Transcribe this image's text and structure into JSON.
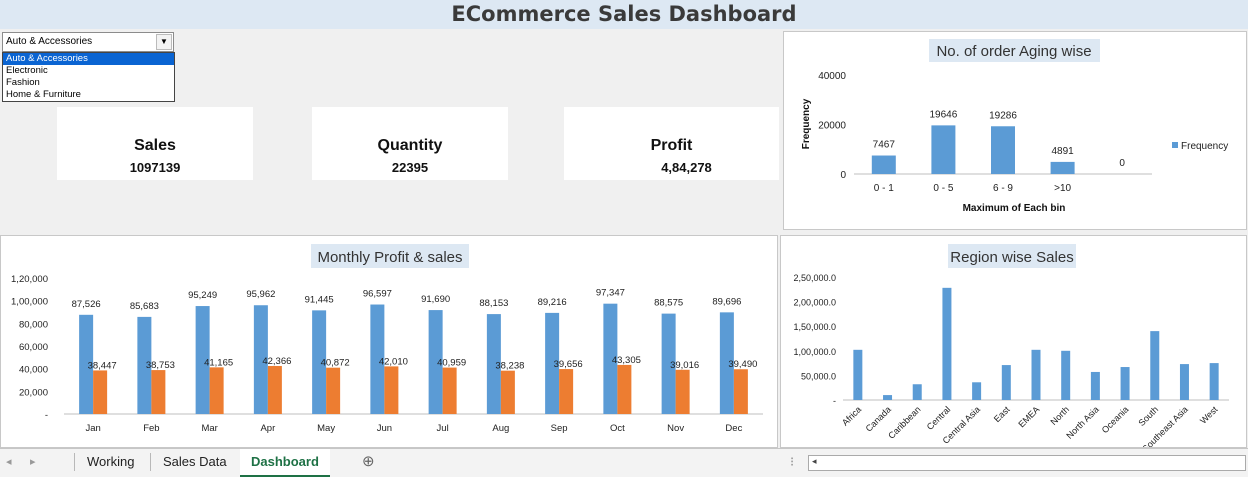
{
  "title": "ECommerce Sales Dashboard",
  "slicer": {
    "selected": "Auto & Accessories",
    "options": [
      "Auto & Accessories",
      "Electronic",
      "Fashion",
      "Home & Furniture"
    ]
  },
  "kpis": [
    {
      "label": "Sales",
      "value": "1097139"
    },
    {
      "label": "Quantity",
      "value": "22395"
    },
    {
      "label": "Profit",
      "value": "4,84,278"
    }
  ],
  "colors": {
    "blue": "#5b9bd5",
    "orange": "#ed7d31",
    "title_bg": "#dde8f3"
  },
  "tabs": {
    "nav_left": "◂",
    "nav_right": "▸",
    "items": [
      "Working",
      "Sales Data",
      "Dashboard"
    ],
    "active": "Dashboard",
    "add_icon": "⊕"
  },
  "scroll": {
    "left_icon": "◂",
    "options_icon": "⁝"
  },
  "chart_data": [
    {
      "type": "bar",
      "title": "No. of order Aging wise",
      "xlabel": "Maximum of Each bin",
      "ylabel": "Frequency",
      "categories": [
        "0 - 1",
        "0 - 5",
        "6 - 9",
        ">10",
        ""
      ],
      "series": [
        {
          "name": "Frequency",
          "values": [
            7467,
            19646,
            19286,
            4891,
            0
          ]
        }
      ],
      "ylim": [
        0,
        40000
      ],
      "yticks": [
        "0",
        "20000",
        "40000"
      ],
      "legend": "right"
    },
    {
      "type": "bar",
      "title": "Monthly Profit & sales",
      "categories": [
        "Jan",
        "Feb",
        "Mar",
        "Apr",
        "May",
        "Jun",
        "Jul",
        "Aug",
        "Sep",
        "Oct",
        "Nov",
        "Dec"
      ],
      "series": [
        {
          "values": [
            87526,
            85683,
            95249,
            95962,
            91445,
            96597,
            91690,
            88153,
            89216,
            97347,
            88575,
            89696
          ],
          "labels": [
            "87,526",
            "85,683",
            "95,249",
            "95,962",
            "91,445",
            "96,597",
            "91,690",
            "88,153",
            "89,216",
            "97,347",
            "88,575",
            "89,696"
          ]
        },
        {
          "values": [
            38447,
            38753,
            41165,
            42366,
            40872,
            42010,
            40959,
            38238,
            39656,
            43305,
            39016,
            39490
          ],
          "labels": [
            "38,447",
            "38,753",
            "41,165",
            "42,366",
            "40,872",
            "42,010",
            "40,959",
            "38,238",
            "39,656",
            "43,305",
            "39,016",
            "39,490"
          ]
        }
      ],
      "ylim": [
        0,
        120000
      ],
      "yticks": [
        "-",
        "20,000",
        "40,000",
        "60,000",
        "80,000",
        "1,00,000",
        "1,20,000"
      ]
    },
    {
      "type": "bar",
      "title": "Region wise Sales",
      "categories": [
        "Africa",
        "Canada",
        "Caribbean",
        "Central",
        "Central Asia",
        "East",
        "EMEA",
        "North",
        "North Asia",
        "Oceania",
        "South",
        "Southeast Asia",
        "West"
      ],
      "series": [
        {
          "values": [
            102000,
            10000,
            32000,
            228000,
            36000,
            71000,
            102000,
            100000,
            57000,
            67000,
            140000,
            73000,
            75000
          ]
        }
      ],
      "ylim": [
        0,
        250000
      ],
      "yticks": [
        "-",
        "50,000.0",
        "1,00,000.0",
        "1,50,000.0",
        "2,00,000.0",
        "2,50,000.0"
      ]
    }
  ]
}
